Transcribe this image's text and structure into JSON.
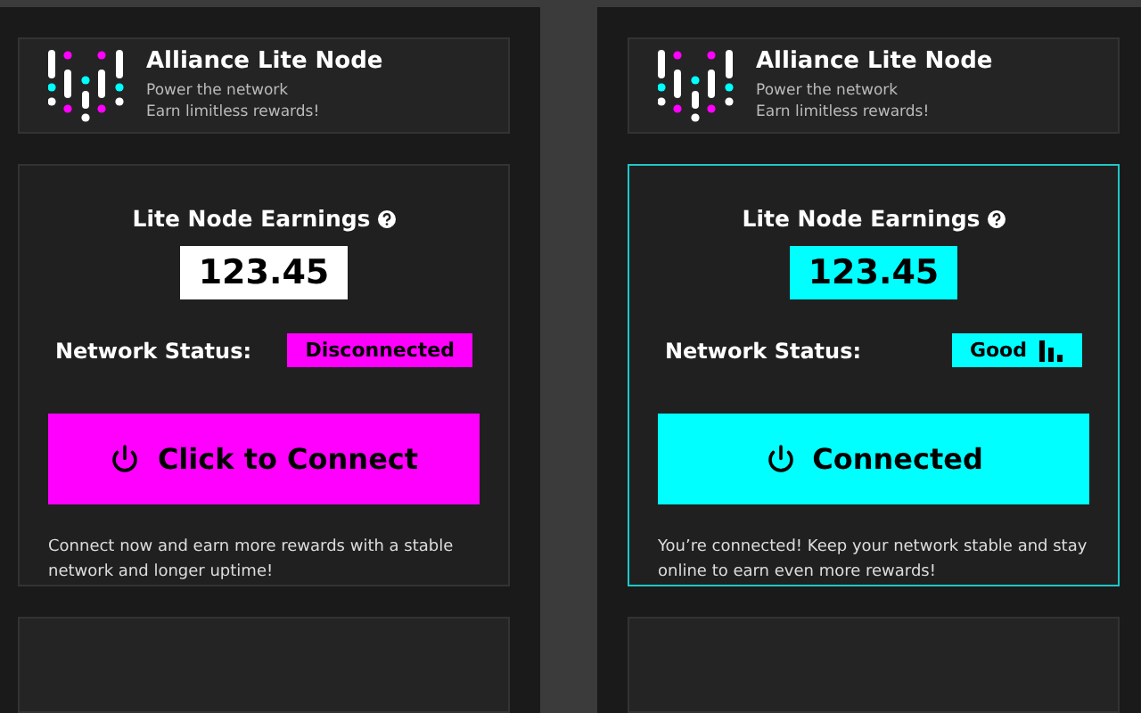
{
  "panels": [
    {
      "connected": false,
      "color": "#ff00ff",
      "header": {
        "title": "Alliance Lite Node",
        "lines": [
          "Power the network",
          "Earn limitless rewards!"
        ]
      },
      "earnings": {
        "title": "Lite Node Earnings",
        "value": "123.45"
      },
      "status": {
        "label": "Network Status:",
        "value": "Disconnected"
      },
      "button": "Click to Connect",
      "note": "Connect now and earn more rewards with a stable network and longer uptime!"
    },
    {
      "connected": true,
      "color": "#00ffff",
      "header": {
        "title": "Alliance Lite Node",
        "lines": [
          "Power the network",
          "Earn limitless rewards!"
        ]
      },
      "earnings": {
        "title": "Lite Node Earnings",
        "value": "123.45"
      },
      "status": {
        "label": "Network Status:",
        "value": "Good"
      },
      "button": "Connected",
      "note": "You’re connected! Keep your network stable and stay online to earn even more rewards!"
    }
  ]
}
